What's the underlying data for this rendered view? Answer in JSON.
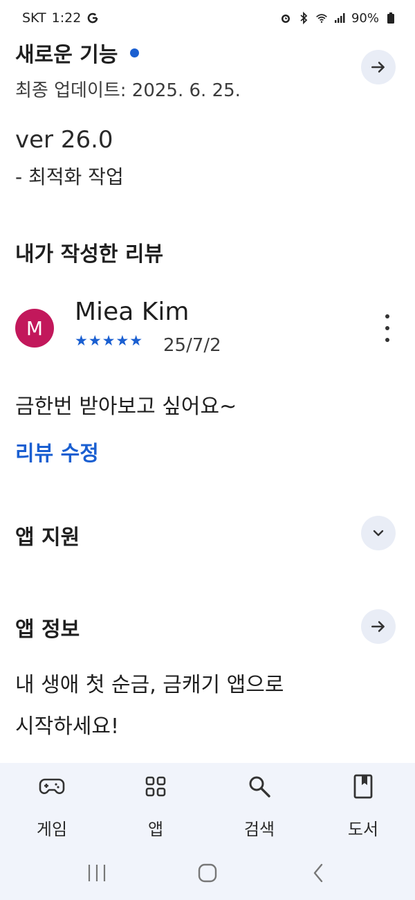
{
  "status_bar": {
    "carrier": "SKT",
    "time": "1:22",
    "battery": "90%",
    "icons": [
      "google-g-icon",
      "alarm-icon",
      "bluetooth-icon",
      "wifi-icon",
      "signal-icon",
      "battery-icon"
    ]
  },
  "whats_new": {
    "title": "새로운 기능",
    "updated": "최종 업데이트: 2025. 6. 25.",
    "version": "ver 26.0",
    "notes": "- 최적화 작업"
  },
  "my_review": {
    "title": "내가 작성한 리뷰",
    "avatar_letter": "M",
    "reviewer": "Miea Kim",
    "stars": "★★★★★",
    "rating": 5,
    "date": "25/7/2",
    "text": "금한번 받아보고 싶어요~",
    "edit_label": "리뷰 수정"
  },
  "app_support": {
    "title": "앱 지원"
  },
  "app_info": {
    "title": "앱 정보",
    "desc_line1": "내 생애 첫 순금, 금캐기 앱으로",
    "desc_line2": "시작하세요!"
  },
  "bottom_nav": {
    "items": [
      {
        "label": "게임",
        "icon": "gamepad-icon"
      },
      {
        "label": "앱",
        "icon": "apps-grid-icon"
      },
      {
        "label": "검색",
        "icon": "search-icon"
      },
      {
        "label": "도서",
        "icon": "book-icon"
      }
    ]
  },
  "colors": {
    "accent": "#1a5fd1",
    "avatar": "#c2185b",
    "nav_bg": "#f1f4fb",
    "circle_btn_bg": "#e9edf6"
  }
}
